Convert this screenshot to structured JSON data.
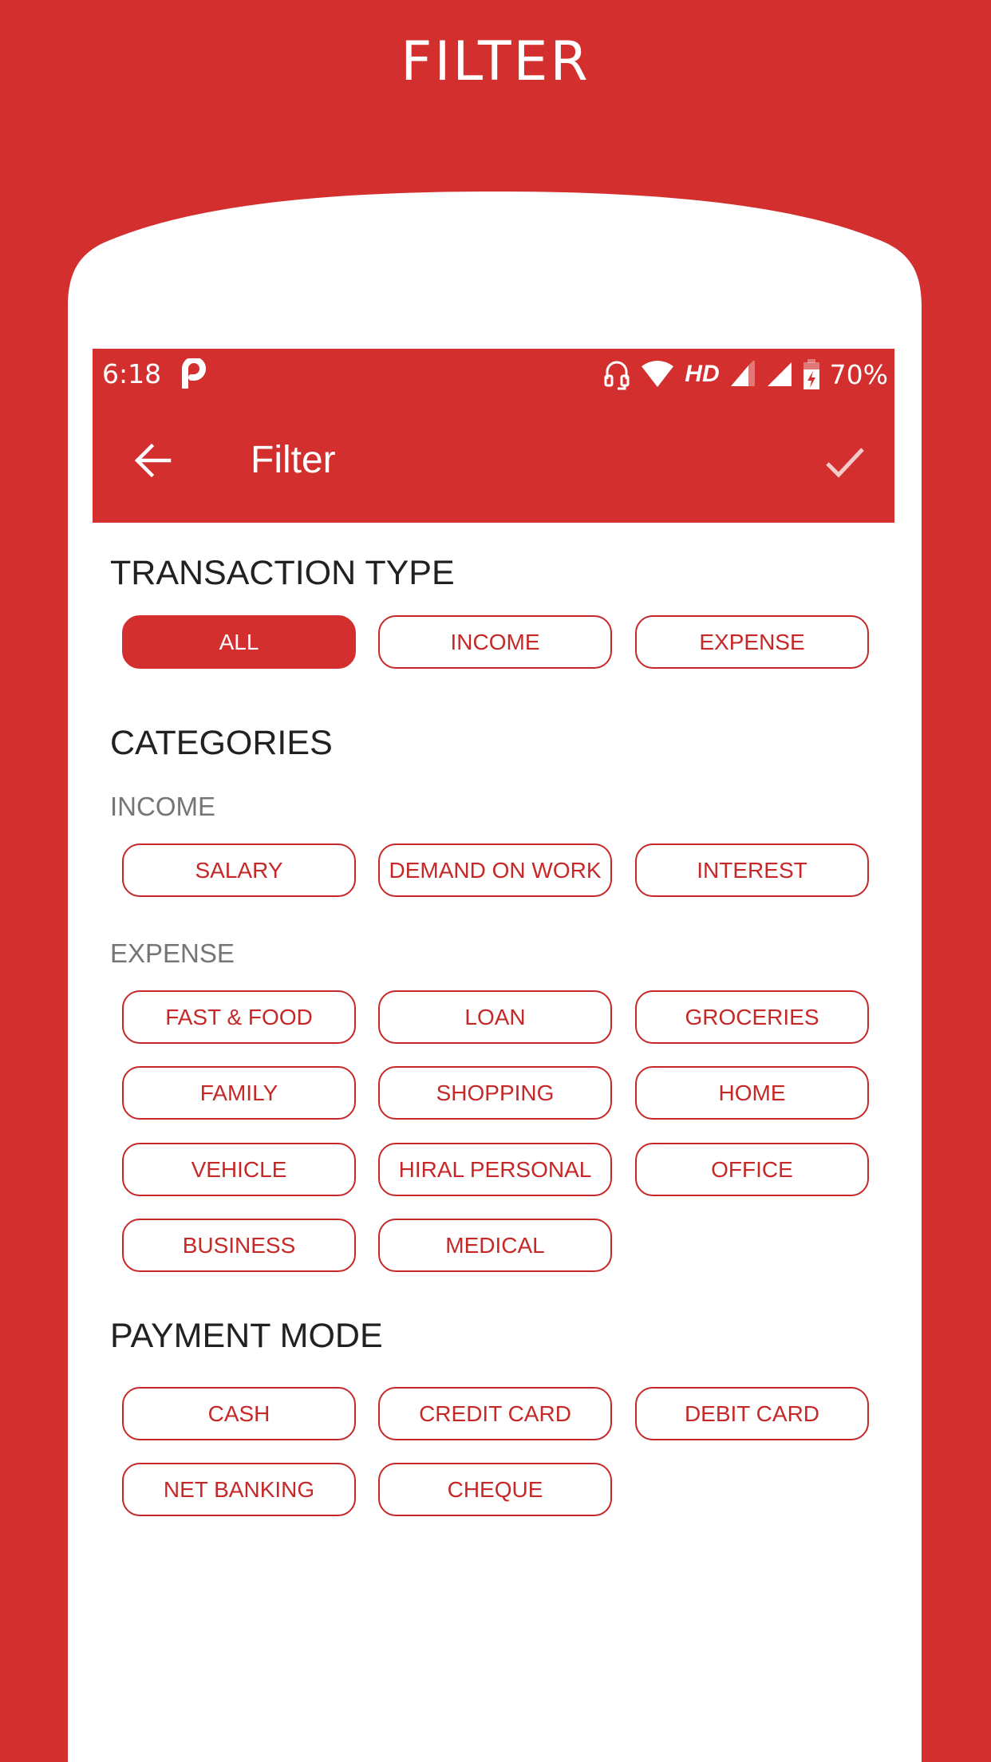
{
  "promo": {
    "title": "FILTER"
  },
  "colors": {
    "brand_red": "#D32F2F",
    "chip_red": "#C62828",
    "heading": "#212121",
    "subheading": "#757575"
  },
  "status_bar": {
    "time": "6:18",
    "notification_icon": "p-app-icon",
    "icons": [
      "headset-icon",
      "wifi-icon",
      "hd-badge",
      "signal-sim1-icon",
      "signal-sim2-icon",
      "battery-charging-icon"
    ],
    "hd_label": "HD",
    "battery_percent": "70%"
  },
  "app_bar": {
    "title": "Filter",
    "back_icon": "arrow-left-icon",
    "confirm_icon": "check-icon"
  },
  "transaction_type": {
    "heading": "TRANSACTION TYPE",
    "options": [
      {
        "label": "ALL",
        "selected": true
      },
      {
        "label": "INCOME",
        "selected": false
      },
      {
        "label": "EXPENSE",
        "selected": false
      }
    ]
  },
  "categories": {
    "heading": "CATEGORIES",
    "income": {
      "label": "INCOME",
      "rows": [
        [
          "SALARY",
          "DEMAND ON WORK",
          "INTEREST"
        ]
      ]
    },
    "expense": {
      "label": "EXPENSE",
      "rows": [
        [
          "FAST & FOOD",
          "LOAN",
          "GROCERIES"
        ],
        [
          "FAMILY",
          "SHOPPING",
          "HOME"
        ],
        [
          "VEHICLE",
          "HIRAL PERSONAL",
          "OFFICE"
        ],
        [
          "BUSINESS",
          "MEDICAL"
        ]
      ]
    }
  },
  "payment_mode": {
    "heading": "PAYMENT MODE",
    "rows": [
      [
        "CASH",
        "CREDIT CARD",
        "DEBIT CARD"
      ],
      [
        "NET BANKING",
        "CHEQUE"
      ]
    ]
  }
}
